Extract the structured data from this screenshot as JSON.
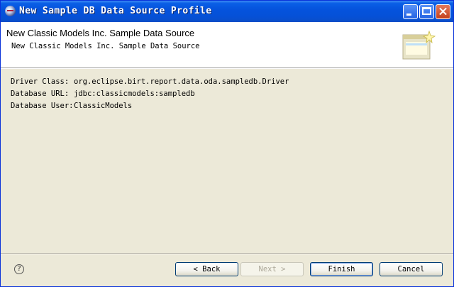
{
  "window": {
    "title": "New Sample DB Data Source Profile",
    "controls": {
      "minimize": "minimize",
      "maximize": "maximize",
      "close": "close"
    }
  },
  "banner": {
    "title": "New Classic Models Inc. Sample Data Source",
    "description": "New Classic Models Inc. Sample Data Source"
  },
  "details": [
    {
      "label": "Driver Class:",
      "value": "org.eclipse.birt.report.data.oda.sampledb.Driver"
    },
    {
      "label": "Database URL:",
      "value": "jdbc:classicmodels:sampledb"
    },
    {
      "label": "Database User:",
      "value": "ClassicModels"
    }
  ],
  "buttons": {
    "back": "< Back",
    "next": "Next >",
    "finish": "Finish",
    "cancel": "Cancel"
  },
  "help": "?"
}
